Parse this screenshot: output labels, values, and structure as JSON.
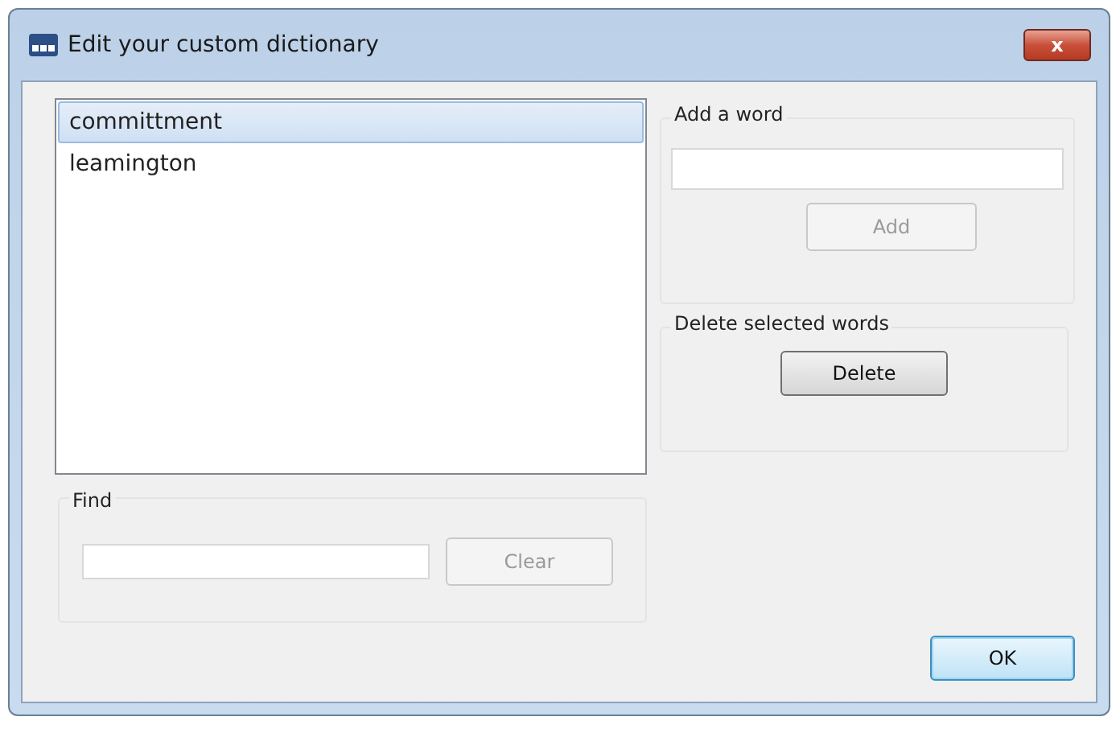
{
  "window": {
    "title": "Edit your custom dictionary",
    "close_label": "x"
  },
  "word_list": [
    {
      "word": "committment",
      "selected": true
    },
    {
      "word": "leamington",
      "selected": false
    }
  ],
  "find": {
    "label": "Find",
    "button": {
      "label": "Clear",
      "disabled": true
    }
  },
  "add_word": {
    "label": "Add a word",
    "button": {
      "label": "Add",
      "disabled": true
    }
  },
  "delete_words": {
    "label": "Delete selected words",
    "button": {
      "label": "Delete",
      "disabled": false
    }
  },
  "ok_button": {
    "label": "OK",
    "disabled": false
  }
}
